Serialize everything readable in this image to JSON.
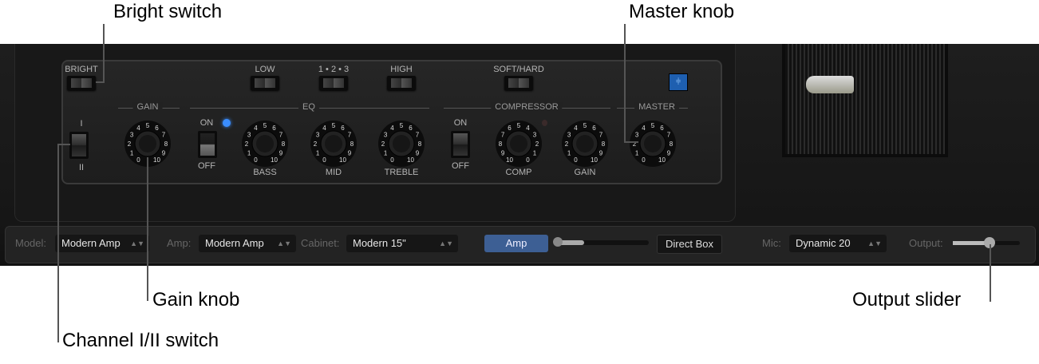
{
  "callouts": {
    "bright": "Bright switch",
    "master": "Master knob",
    "gain": "Gain knob",
    "channel": "Channel I/II switch",
    "output": "Output slider"
  },
  "amp": {
    "switches": {
      "bright": "BRIGHT",
      "low": "LOW",
      "mid_select": "1 • 2 • 3",
      "high": "HIGH",
      "soft_hard": "SOFT/HARD"
    },
    "sections": {
      "gain": "GAIN",
      "eq": "EQ",
      "compressor": "COMPRESSOR",
      "master": "MASTER"
    },
    "channel": {
      "top": "I",
      "bottom": "II"
    },
    "eq_on": "ON",
    "eq_off": "OFF",
    "comp_on": "ON",
    "comp_off": "OFF",
    "knob_labels": {
      "bass": "BASS",
      "mid": "MID",
      "treble": "TREBLE",
      "comp": "COMP",
      "gain": "GAIN"
    },
    "scale": [
      "0",
      "1",
      "2",
      "3",
      "4",
      "5",
      "6",
      "7",
      "8",
      "9",
      "10"
    ],
    "comp_scale": [
      "10",
      "9",
      "8",
      "7",
      "6",
      "5",
      "4",
      "3",
      "2",
      "1",
      "0"
    ],
    "led_color": "#3a8dff"
  },
  "bar": {
    "model_label": "Model:",
    "model": "Modern Amp",
    "amp_label": "Amp:",
    "amp": "Modern Amp",
    "cabinet_label": "Cabinet:",
    "cabinet": "Modern 15\"",
    "amp_button": "Amp",
    "direct_box_button": "Direct Box",
    "blend": 0.3,
    "mic_label": "Mic:",
    "mic": "Dynamic 20",
    "output_label": "Output:",
    "output": 0.55,
    "accent": "#3d5f94"
  }
}
